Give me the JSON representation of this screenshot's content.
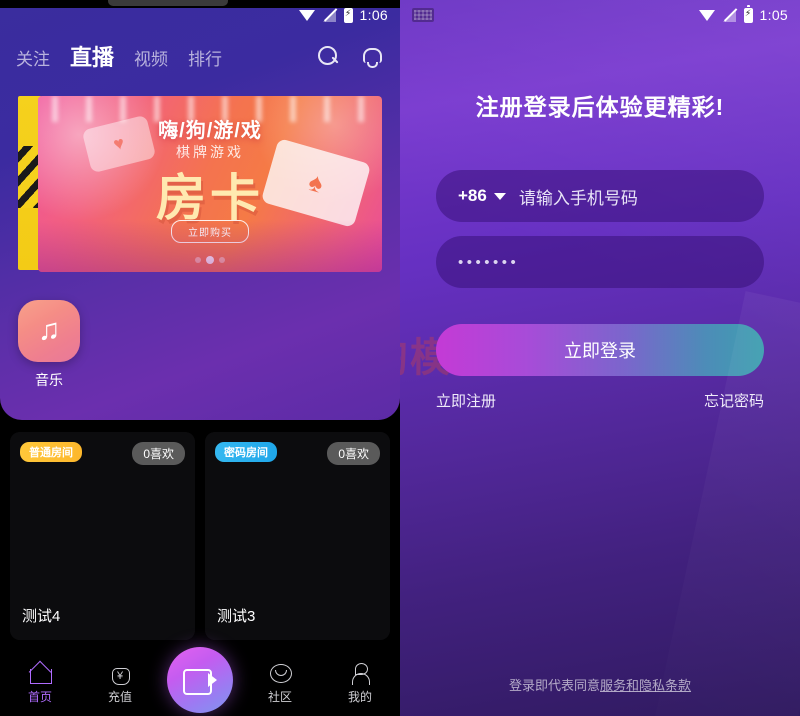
{
  "left": {
    "statusbar": {
      "time": "1:06",
      "icons": [
        "wifi-icon",
        "no-signal-icon",
        "battery-charging-icon"
      ]
    },
    "tabs": [
      {
        "label": "关注",
        "active": false
      },
      {
        "label": "直播",
        "active": true
      },
      {
        "label": "视频",
        "active": false
      },
      {
        "label": "排行",
        "active": false
      }
    ],
    "nav_icons": [
      "search-icon",
      "bell-icon"
    ],
    "banner": {
      "headline": "嗨/狗/游/戏",
      "subhead": "棋牌游戏",
      "title": "房卡",
      "cta": "立即购买",
      "dots": 3,
      "active_dot": 1
    },
    "categories": [
      {
        "label": "音乐",
        "icon": "music-note-icon"
      }
    ],
    "cards": [
      {
        "badge": "普通房间",
        "badge_type": "normal",
        "likes": "0喜欢",
        "title": "测试4"
      },
      {
        "badge": "密码房间",
        "badge_type": "password",
        "likes": "0喜欢",
        "title": "测试3"
      }
    ],
    "tabbar": [
      {
        "label": "首页",
        "icon": "home-icon",
        "active": true
      },
      {
        "label": "充值",
        "icon": "money-bag-icon",
        "active": false
      },
      {
        "label": "社区",
        "icon": "chat-bubble-icon",
        "active": false
      },
      {
        "label": "我的",
        "icon": "user-icon",
        "active": false
      }
    ],
    "tabbar_center": {
      "icon": "video-camera-icon"
    }
  },
  "right": {
    "statusbar": {
      "time": "1:05",
      "icons": [
        "keyboard-icon",
        "wifi-icon",
        "no-signal-icon",
        "battery-charging-icon"
      ]
    },
    "title": "注册登录后体验更精彩!",
    "phone_field": {
      "country_code": "+86",
      "placeholder": "请输入手机号码",
      "value": ""
    },
    "password_field": {
      "value": "•••••••",
      "placeholder": ""
    },
    "login_button": "立即登录",
    "register_link": "立即注册",
    "forgot_link": "忘记密码",
    "watermark": "一淘模版",
    "terms_prefix": "登录即代表同意",
    "terms_link": "服务和隐私条款"
  },
  "colors": {
    "left_panel_purple": "#5a2fa8",
    "banner_orange": "#f4734f",
    "badge_normal": "#ffc83a",
    "badge_password": "#35b8f0",
    "accent_purple": "#b06cff",
    "login_gradient_start": "#c43ad6",
    "login_gradient_end": "#3e9fb0",
    "watermark_red": "#e8472e"
  }
}
